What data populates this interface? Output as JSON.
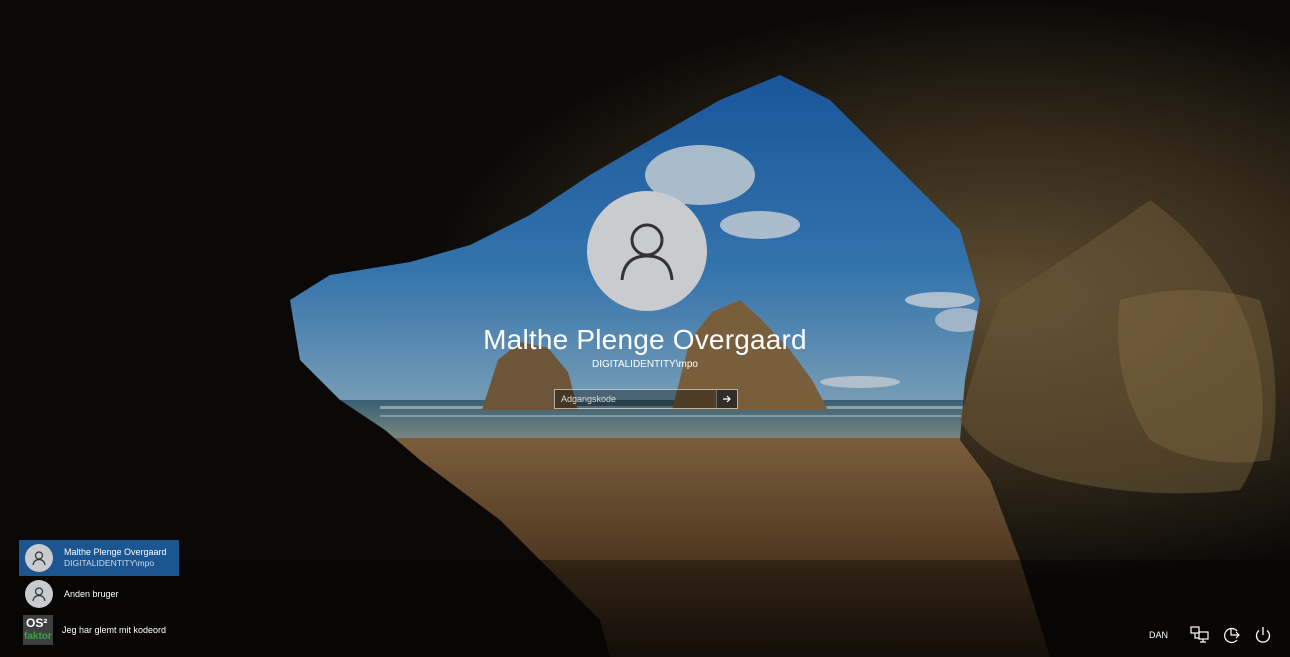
{
  "user": {
    "name": "Malthe Plenge Overgaard",
    "domain": "DIGITALIDENTITY\\mpo"
  },
  "password": {
    "placeholder": "Adgangskode",
    "value": ""
  },
  "accounts": [
    {
      "name": "Malthe Plenge Overgaard",
      "sub": "DIGITALIDENTITY\\mpo",
      "selected": true
    },
    {
      "name": "Anden bruger"
    },
    {
      "name": "Jeg har glemt mit kodeord",
      "logo_text": "OS² faktor"
    }
  ],
  "tray": {
    "language": "DAN",
    "icons": [
      "network-icon",
      "accessibility-icon",
      "power-icon"
    ]
  },
  "colors": {
    "selected_account_bg": "#1b5691",
    "avatar_bg": "#c9cbcf"
  }
}
